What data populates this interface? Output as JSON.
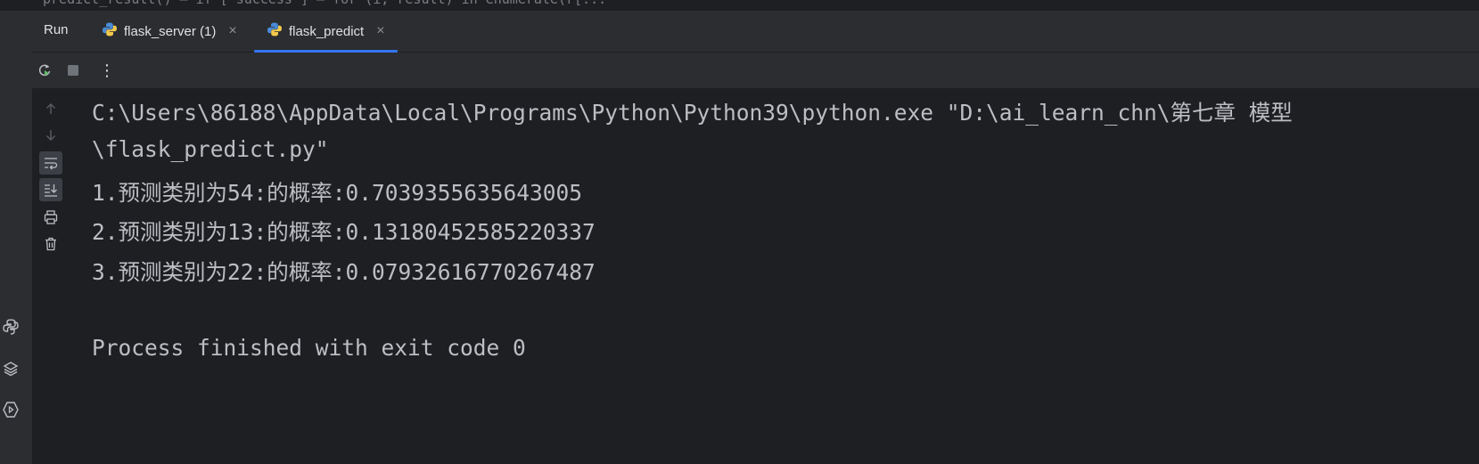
{
  "top_strip": {
    "text": "predict_result() — if [\"success\"] — for (i, result) in enumerate(r[..."
  },
  "tabbar": {
    "run_label": "Run",
    "tabs": [
      {
        "label": "flask_server (1)",
        "icon": "python-icon",
        "active": false
      },
      {
        "label": "flask_predict",
        "icon": "python-icon",
        "active": true
      }
    ],
    "close_glyph": "×"
  },
  "toolbar": {
    "items": [
      "rerun-icon",
      "stop-icon",
      "more-options-icon"
    ],
    "more_glyph": "⋮"
  },
  "gutter": {
    "items": [
      "up-arrow-icon",
      "down-arrow-icon",
      "soft-wrap-icon",
      "scroll-to-end-icon",
      "print-icon",
      "trash-icon"
    ]
  },
  "console": {
    "lines": [
      "C:\\Users\\86188\\AppData\\Local\\Programs\\Python\\Python39\\python.exe \"D:\\ai_learn_chn\\第七章 模型",
      " \\flask_predict.py\"",
      "1.预测类别为54:的概率:0.7039355635643005",
      "2.预测类别为13:的概率:0.13180452585220337",
      "3.预测类别为22:的概率:0.07932616770267487",
      "",
      "Process finished with exit code 0"
    ]
  },
  "left_rail": {
    "items": [
      "python-console-icon",
      "layers-icon",
      "services-icon"
    ]
  },
  "colors": {
    "background": "#1e1f22",
    "panel": "#2b2d30",
    "text": "#bcbec4",
    "accent": "#3574f0",
    "rerun_green": "#5fb865"
  }
}
